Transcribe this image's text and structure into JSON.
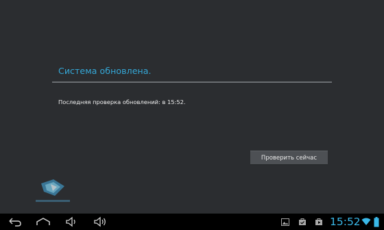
{
  "dialog": {
    "title": "Система обновлена.",
    "message": "Последняя проверка обновлений: в 15:52.",
    "check_button_label": "Проверить сейчас"
  },
  "status_bar": {
    "time": "15:52",
    "icons": [
      "gallery-icon",
      "store-icon",
      "play-store-icon",
      "wifi-icon",
      "battery-icon"
    ]
  },
  "nav_bar": {
    "buttons": [
      "back-icon",
      "home-icon",
      "volume-down-icon",
      "volume-up-icon"
    ]
  },
  "colors": {
    "background": "#2b2d30",
    "accent": "#35a9d9",
    "clock": "#3ab8e8",
    "button": "#4d5054",
    "navbar": "#000000"
  }
}
